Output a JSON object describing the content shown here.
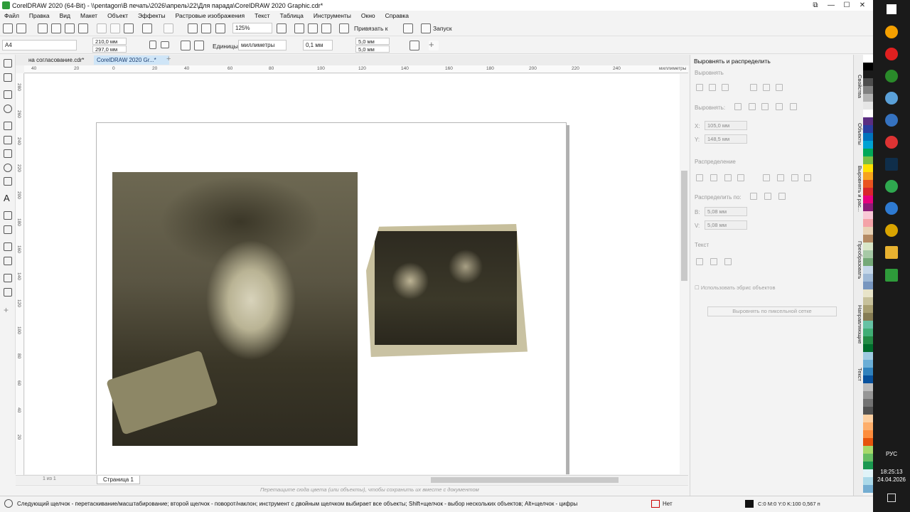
{
  "title": "CorelDRAW 2020 (64-Bit) - \\\\pentagon\\В печать\\2026\\апрель\\22\\Для парада\\CorelDRAW 2020 Graphic.cdr*",
  "window_controls": [
    "⧉",
    "—",
    "☐",
    "✕"
  ],
  "menu": [
    "Файл",
    "Правка",
    "Вид",
    "Макет",
    "Объект",
    "Эффекты",
    "Растровые изображения",
    "Текст",
    "Таблица",
    "Инструменты",
    "Окно",
    "Справка"
  ],
  "toolbar": {
    "zoom": "125%",
    "snap_label": "Привязать к",
    "launch_label": "Запуск"
  },
  "propbar": {
    "paper": "A4",
    "width": "210,0 мм",
    "height": "297,0 мм",
    "units_label": "Единицы:",
    "units_value": "миллиметры",
    "nudge": "0,1 мм",
    "dup_x": "5,0 мм",
    "dup_y": "5,0 мм"
  },
  "tabs": [
    "на согласование.cdr*",
    "CorelDRAW 2020 Gr...*"
  ],
  "ruler": {
    "top_labels": [
      "40",
      "20",
      "0",
      "20",
      "40",
      "60",
      "80",
      "100",
      "120",
      "140",
      "160",
      "180",
      "200",
      "220",
      "240",
      "260"
    ],
    "unit": "миллиметры",
    "left_labels": [
      "280",
      "260",
      "240",
      "220",
      "200",
      "180",
      "160",
      "140",
      "120",
      "100",
      "80",
      "60",
      "40",
      "20"
    ]
  },
  "pagenav": {
    "counter": "1 из 1",
    "page_tab": "Страница 1"
  },
  "drag_hint": "Перетащите сюда цвета (или объекты), чтобы сохранить их вместе с документом",
  "status": {
    "text": "Следующий щелчок - перетаскивание/масштабирование; второй щелчок - поворот/наклон; инструмент с двойным щелчком выбирает все объекты; Shift+щелчок - выбор нескольких объектов; Alt+щелчок - цифры",
    "fill": "Нет",
    "outline": "C:0 M:0 Y:0 K:100  0,567 п"
  },
  "docker": {
    "title": "Выровнять и распределить",
    "align_label": "Выровнять",
    "align_to_label": "Выровнять:",
    "x_value": "105,0 мм",
    "y_value": "148,5 мм",
    "distribute_label": "Распределение",
    "distribute_to_label": "Распределить по:",
    "h_value": "5,08 мм",
    "v_value": "5,08 мм",
    "text_label": "Текст",
    "use_outline": "Использовать эбрис объектов",
    "pixel_grid": "Выровнять по пиксельной сетке"
  },
  "side_tabs": [
    "Свойства",
    "Объекты",
    "Выровнять и рас...",
    "Преобразовать",
    "Направляющие",
    "Текст"
  ],
  "palette": [
    "#ffffff",
    "#000000",
    "#1a1a1a",
    "#4d4d4d",
    "#808080",
    "#b3b3b3",
    "#e6e6e6",
    "#ffffff",
    "#5a2d82",
    "#2a3ea0",
    "#0073bd",
    "#00a2d3",
    "#00a859",
    "#7bbf45",
    "#ffe100",
    "#f6a21e",
    "#e9541f",
    "#d9262c",
    "#e6007e",
    "#8d1c78",
    "#f9c8d6",
    "#f4a3a8",
    "#e8d3b6",
    "#b48a63",
    "#d8e6c7",
    "#a7c9a6",
    "#75a978",
    "#c5d7e9",
    "#9fb9d6",
    "#7896bf",
    "#e8e4c9",
    "#c7c19b",
    "#a89f72",
    "#857c54",
    "#66c2a4",
    "#41ae76",
    "#238b45",
    "#006d2c",
    "#9ecae1",
    "#6baed6",
    "#3182bd",
    "#08519c",
    "#bdbdbd",
    "#969696",
    "#737373",
    "#525252",
    "#fdd0a2",
    "#fdae6b",
    "#fd8d3c",
    "#e6550d",
    "#a6d96a",
    "#66bd63",
    "#1a9850",
    "#e0f3f8",
    "#abd9e9",
    "#74add1"
  ],
  "taskbar": {
    "lang": "РУС",
    "time": "18:25:13",
    "date": "24.04.2026"
  }
}
